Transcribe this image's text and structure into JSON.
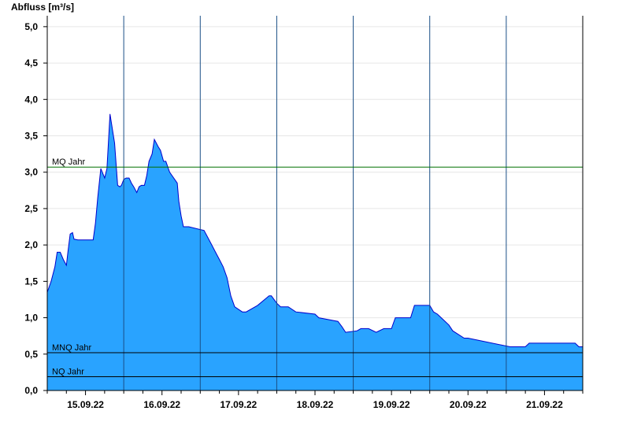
{
  "chart_data": {
    "type": "area",
    "ylabel": "Abfluss [m³/s]",
    "ylim": [
      0,
      5.15
    ],
    "yticks": [
      "0,0",
      "0,5",
      "1,0",
      "1,5",
      "2,0",
      "2,5",
      "3,0",
      "3,5",
      "4,0",
      "4,5",
      "5,0"
    ],
    "xlim_days": [
      0,
      7
    ],
    "date_labels": [
      "15.09.22",
      "16.09.22",
      "17.09.22",
      "18.09.22",
      "19.09.22",
      "20.09.22",
      "21.09.22"
    ],
    "x_start": "14.09.22 12:00",
    "grid": true,
    "fill_color": "#29A3FF",
    "line_color": "#0000CC",
    "reference_lines": [
      {
        "name": "MQ Jahr",
        "value": 3.07,
        "color": "#007000"
      },
      {
        "name": "MNQ Jahr",
        "value": 0.52,
        "color": "#000000"
      },
      {
        "name": "NQ Jahr",
        "value": 0.19,
        "color": "#000000"
      }
    ],
    "series": [
      {
        "x": [
          0,
          0.05,
          0.1,
          0.13,
          0.17,
          0.21,
          0.25,
          0.27,
          0.3,
          0.33,
          0.35,
          0.4,
          0.6,
          0.63,
          0.66,
          0.7,
          0.75,
          0.78,
          0.82,
          0.85,
          0.88,
          0.92,
          0.95,
          0.97,
          1.0,
          1.03,
          1.07,
          1.1,
          1.13,
          1.17,
          1.2,
          1.23,
          1.27,
          1.3,
          1.33,
          1.37,
          1.4,
          1.45,
          1.48,
          1.52,
          1.55,
          1.6,
          1.7,
          1.72,
          1.75,
          1.78,
          1.8,
          1.85,
          2.05,
          2.1,
          2.15,
          2.2,
          2.25,
          2.3,
          2.35,
          2.4,
          2.45,
          2.55,
          2.6,
          2.75,
          2.9,
          2.93,
          3.0,
          3.05,
          3.15,
          3.25,
          3.5,
          3.55,
          3.8,
          3.85,
          3.9,
          4.05,
          4.1,
          4.15,
          4.2,
          4.3,
          4.4,
          4.5,
          4.55,
          4.75,
          4.8,
          5.0,
          5.05,
          5.1,
          5.15,
          5.25,
          5.3,
          5.45,
          5.5,
          6.05,
          6.1,
          6.2,
          6.25,
          6.3,
          6.4,
          6.9,
          6.95,
          7.0
        ],
        "y": [
          1.35,
          1.5,
          1.7,
          1.9,
          1.9,
          1.8,
          1.72,
          1.9,
          2.15,
          2.17,
          2.08,
          2.07,
          2.07,
          2.3,
          2.65,
          3.05,
          2.92,
          3.05,
          3.8,
          3.6,
          3.4,
          2.82,
          2.8,
          2.82,
          2.9,
          2.92,
          2.92,
          2.85,
          2.8,
          2.72,
          2.8,
          2.82,
          2.82,
          2.95,
          3.15,
          3.25,
          3.45,
          3.35,
          3.3,
          3.15,
          3.15,
          3.0,
          2.85,
          2.6,
          2.4,
          2.25,
          2.25,
          2.25,
          2.2,
          2.1,
          2.0,
          1.9,
          1.8,
          1.7,
          1.55,
          1.3,
          1.15,
          1.08,
          1.08,
          1.17,
          1.3,
          1.3,
          1.2,
          1.15,
          1.15,
          1.08,
          1.05,
          1.0,
          0.95,
          0.88,
          0.8,
          0.82,
          0.85,
          0.85,
          0.85,
          0.8,
          0.85,
          0.85,
          1.0,
          1.0,
          1.17,
          1.17,
          1.08,
          1.05,
          1.0,
          0.9,
          0.82,
          0.72,
          0.72,
          0.6,
          0.6,
          0.6,
          0.6,
          0.65,
          0.65,
          0.65,
          0.6,
          0.6
        ]
      }
    ]
  }
}
